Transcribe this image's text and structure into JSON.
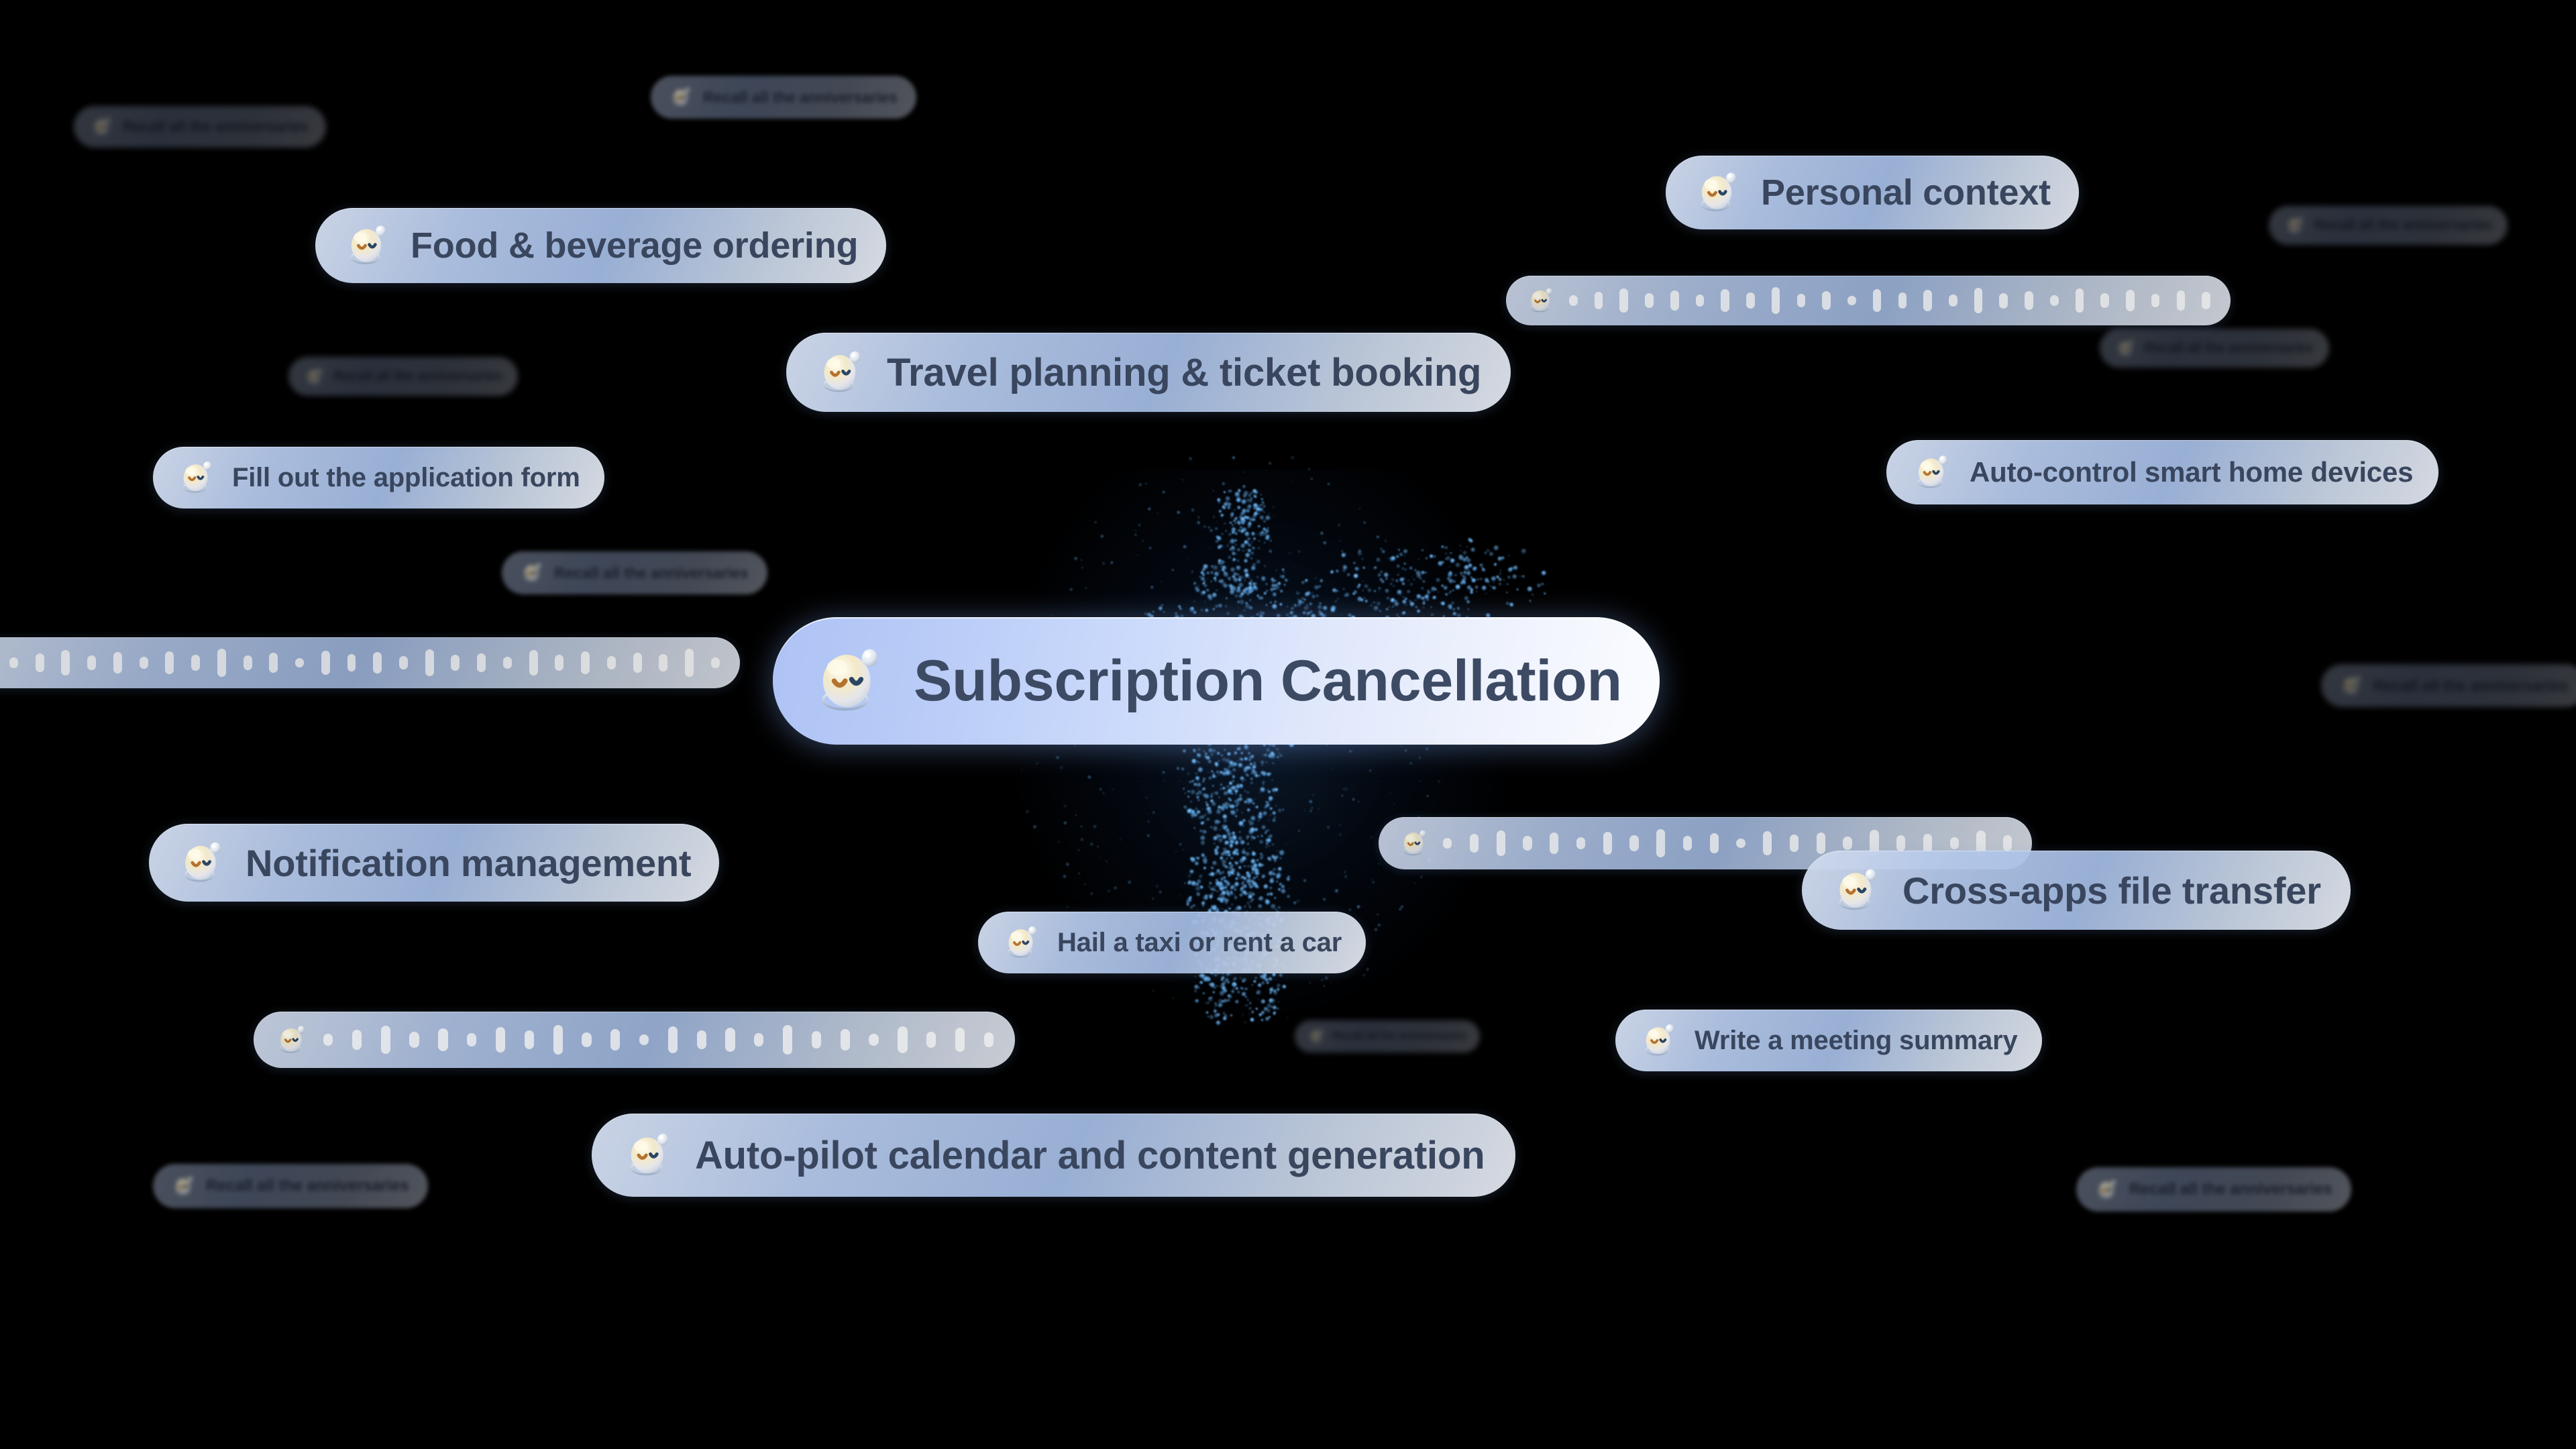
{
  "scene": {
    "background_color": "#000000",
    "accent_color": "#aec3f5",
    "text_color": "#39465e",
    "figure": "particle-human-figure"
  },
  "hero": {
    "label": "Subscription Cancellation",
    "icon": "robot-avatar-icon"
  },
  "pills": [
    {
      "id": "personal-context",
      "label": "Personal context",
      "kind": "text"
    },
    {
      "id": "food-beverage-ordering",
      "label": "Food & beverage ordering",
      "kind": "text"
    },
    {
      "id": "travel-planning",
      "label": "Travel planning & ticket booking",
      "kind": "text"
    },
    {
      "id": "fill-application-form",
      "label": "Fill out the application form",
      "kind": "text"
    },
    {
      "id": "auto-control-smart-home",
      "label": "Auto-control smart home devices",
      "kind": "text"
    },
    {
      "id": "notification-management",
      "label": "Notification management",
      "kind": "text"
    },
    {
      "id": "cross-apps-file-transfer",
      "label": "Cross-apps file transfer",
      "kind": "text"
    },
    {
      "id": "hail-taxi-rent-car",
      "label": "Hail a taxi or rent a car",
      "kind": "text"
    },
    {
      "id": "write-meeting-summary",
      "label": "Write a meeting summary",
      "kind": "text"
    },
    {
      "id": "auto-pilot-calendar",
      "label": "Auto-pilot calendar and content generation",
      "kind": "text"
    }
  ],
  "faded_pills": [
    {
      "id": "recall-anniversaries-1",
      "label": "Recall all the anniversaries"
    },
    {
      "id": "recall-anniversaries-2",
      "label": "Recall all the anniversaries"
    },
    {
      "id": "recall-anniversaries-3",
      "label": "Recall all the anniversaries"
    },
    {
      "id": "recall-anniversaries-4",
      "label": "Recall all the anniversaries"
    },
    {
      "id": "recall-anniversaries-5",
      "label": "Recall all the anniversaries"
    },
    {
      "id": "recall-anniversaries-6",
      "label": "Recall all the anniversaries"
    },
    {
      "id": "recall-anniversaries-7",
      "label": "Recall all the anniversaries"
    },
    {
      "id": "recall-anniversaries-8",
      "label": "Recall all the anniversaries"
    },
    {
      "id": "recall-anniversaries-9",
      "label": "Recall all the anniversaries"
    }
  ],
  "voice_pills": [
    {
      "id": "voice-message-1",
      "icon": "waveform-icon",
      "bars": 26
    },
    {
      "id": "voice-message-2",
      "icon": "waveform-icon",
      "bars": 28
    },
    {
      "id": "voice-message-3",
      "icon": "waveform-icon",
      "bars": 22
    },
    {
      "id": "voice-message-4",
      "icon": "waveform-icon",
      "bars": 24
    }
  ]
}
